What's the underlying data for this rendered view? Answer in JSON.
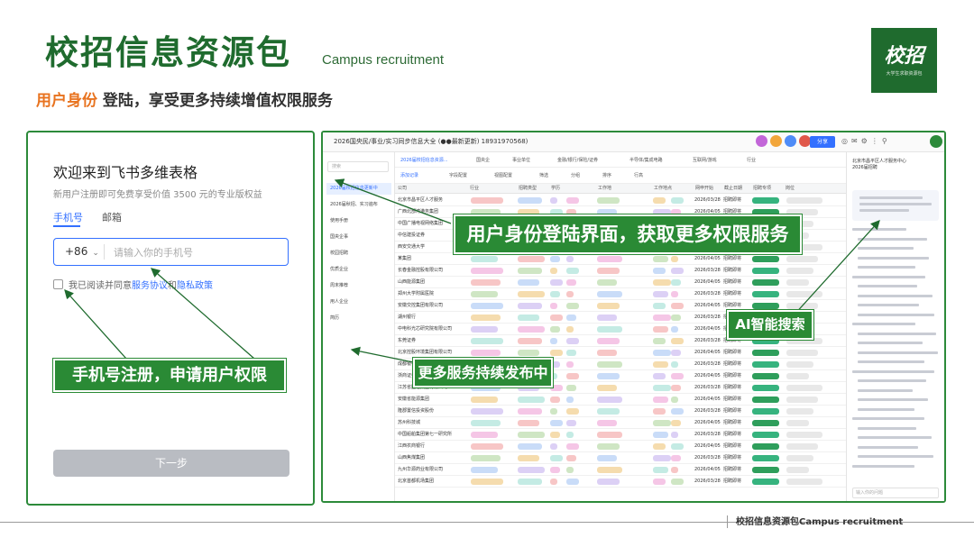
{
  "header": {
    "title": "校招信息资源包",
    "subtitle": "Campus recruitment",
    "logo_text": "校招",
    "logo_small": "大学生求职资源包",
    "tagline_highlight": "用户身份",
    "tagline_rest": " 登陆，享受更多持续增值权限服务"
  },
  "login": {
    "title": "欢迎来到飞书多维表格",
    "subtitle": "新用户注册即可免费享受价值 3500 元的专业版权益",
    "tab_phone": "手机号",
    "tab_email": "邮箱",
    "country_code": "+86",
    "phone_placeholder": "请输入你的手机号",
    "agree_prefix": "我已阅读并同意 ",
    "service_link": "服务协议",
    "agree_and": " 和 ",
    "privacy_link": "隐私政策",
    "next_button": "下一步"
  },
  "sheet": {
    "doc_title": "2026国央民/事业/实习同步信息大全  (●●最新更新) 18931970568)",
    "share_label": "分享",
    "search_placeholder": "搜索",
    "sidebar_items": [
      "2026届校招信息更新中",
      "2026届秋招、实习遍布",
      "使用手册",
      "国央企事",
      "校园招聘",
      "优质企业",
      "周末推荐",
      "用人企业",
      "简历"
    ],
    "tabs": [
      "2026届校招信息资源...",
      "国央企",
      "事业单位",
      "金融/银行/保险/证券",
      "半导体/集成电路",
      "互联网/游戏",
      "行业"
    ],
    "toolbar": [
      "添加记录",
      "字段配置",
      "视图配置",
      "筛选",
      "分组",
      "排序",
      "行高"
    ],
    "columns": [
      "公司",
      "行业",
      "招聘类型",
      "学历",
      "工作地",
      "工作地点",
      "网申开始",
      "截止日期",
      "招聘专项",
      "岗位"
    ],
    "row_companies": [
      "北京市昌平区人才服务",
      "广西北部湾港务集团",
      "中国广播电视网络集团",
      "中信建投证券",
      "西安交通大学",
      "某集团",
      "长春金融控股有限公司",
      "山西能源集团",
      "郑州大学附属医院",
      "安徽交控集团有限公司",
      "湖州银行",
      "中电科光芯研究院有限公司",
      "东莞证券",
      "北京控股环境集团有限公司",
      "成都银行",
      "浙商证券",
      "江苏省国信集团有限公司",
      "安徽省能源集团",
      "隆郡置信投资股份",
      "苏州科技城",
      "中国船舶集团第七一研究所",
      "江西农商银行",
      "山西焦煤集团",
      "九州华源药业有限公司",
      "北京首都机场集团"
    ],
    "date_a": "2026/03/28",
    "date_b": "2026/04/05",
    "deadline_label": "招聘即将"
  },
  "ai_panel": {
    "title": "北京市昌平区人才服务中心2026届招聘",
    "input_placeholder": "输入你的问题"
  },
  "callouts": {
    "login_callout": "用户身份登陆界面，获取更多权限服务",
    "ai_callout": "AI智能搜索",
    "service_callout": "更多服务持续发布中",
    "phone_callout": "手机号注册，申请用户权限"
  },
  "footer": {
    "text": "校招信息资源包Campus recruitment"
  },
  "colors": {
    "brand_green": "#1f6b2e",
    "accent_orange": "#e8731f",
    "link_blue": "#3370ff"
  }
}
